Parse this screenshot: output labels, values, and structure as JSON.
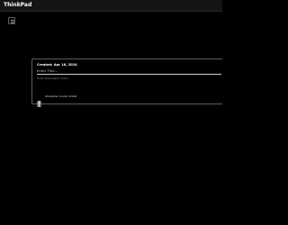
{
  "app": {
    "title": "ThinkPad"
  },
  "toolbar": {
    "menu_icon": "hamburger-menu-icon"
  },
  "note_card": {
    "created_label": "Created: Apr 16, 2024",
    "title_input": {
      "value": "",
      "placeholder": "Enter Title..."
    },
    "description_input": {
      "value": "",
      "placeholder": "Enter Description Here..."
    },
    "delete_icon": "trash-icon",
    "character_count": "Character Count: 0/140"
  },
  "colors": {
    "background": "#000000",
    "topbar": "#141414",
    "card_border": "#5c5c5c",
    "text": "#ffffff"
  }
}
